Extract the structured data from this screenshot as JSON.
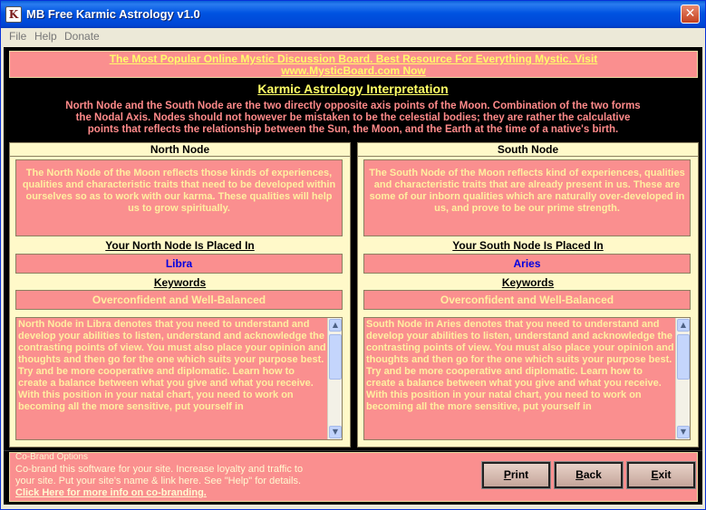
{
  "window": {
    "title": "MB Free Karmic Astrology v1.0",
    "close_glyph": "✕",
    "icon_glyph": "K"
  },
  "menu": [
    {
      "label": "File"
    },
    {
      "label": "Help"
    },
    {
      "label": "Donate"
    }
  ],
  "ad": {
    "line1": "The Most Popular Online Mystic Discussion Board. Best Resource For Everything Mystic. Visit",
    "line2": "www.MysticBoard.com Now"
  },
  "interpretation": {
    "title": "Karmic Astrology Interpretation",
    "line1": "North Node and the South Node are the two directly opposite axis points of the Moon. Combination of the two forms",
    "line2": "the Nodal Axis. Nodes should not however be mistaken to be the celestial bodies; they are rather the calculative",
    "line3": "points that reflects the relationship between the Sun, the Moon, and the Earth at the time of a native's birth."
  },
  "north": {
    "heading": "North Node",
    "description": "The North Node of the Moon reflects those kinds of experiences, qualities and characteristic traits that need to be developed within ourselves so as to work with our karma. These qualities will help us to grow spiritually.",
    "placed_title": "Your North Node Is Placed In",
    "sign": "Libra",
    "keywords_title": "Keywords",
    "keywords": "Overconfident and Well-Balanced",
    "detail": "North Node in Libra denotes that you need to understand and develop your abilities to listen, understand and acknowledge the contrasting points of view. You must also place your opinion and thoughts and then go for the one which suits your purpose best. Try and be more cooperative and diplomatic. Learn how to create a balance between what you give and what you receive. With this position in your natal chart, you need to work on becoming all the more sensitive, put yourself in"
  },
  "south": {
    "heading": "South Node",
    "description": "The South Node of the Moon reflects kind of experiences, qualities and characteristic traits that are already present in us. These are some of our inborn qualities which are naturally over-developed in us, and prove to be our prime strength.",
    "placed_title": "Your South Node Is Placed In",
    "sign": "Aries",
    "keywords_title": "Keywords",
    "keywords": "Overconfident and Well-Balanced",
    "detail": "South Node in Aries denotes that you need to understand and develop your abilities to listen, understand and acknowledge the contrasting points of view. You must also place your opinion and thoughts and then go for the one which suits your purpose best. Try and be more cooperative and diplomatic. Learn how to create a balance between what you give and what you receive. With this position in your natal chart, you need to work on becoming all the more sensitive, put yourself in"
  },
  "scroll": {
    "up_glyph": "▲",
    "down_glyph": "▼"
  },
  "cobrand": {
    "legend": "Co-Brand Options",
    "line1": "Co-brand this software for your site.  Increase loyalty and traffic to",
    "line2": "your site. Put your site's name &  link here. See \"Help\" for details.",
    "link": "Click Here for more info on co-branding."
  },
  "buttons": {
    "print_first": "P",
    "print_rest": "rint",
    "back_first": "B",
    "back_rest": "ack",
    "exit_first": "E",
    "exit_rest": "xit"
  },
  "colors": {
    "accent_pink": "#fa8f8f",
    "panel_cream": "#fff9c9",
    "title_yellow": "#ffff66",
    "sign_blue": "#0000e0"
  }
}
